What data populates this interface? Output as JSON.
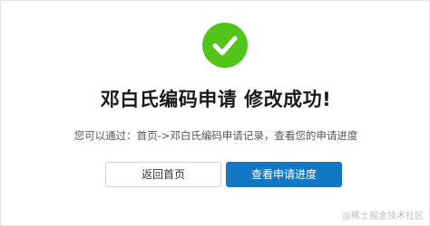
{
  "result": {
    "icon": "check-circle-icon",
    "icon_color": "#52c41a",
    "title": "邓白氏编码申请 修改成功!",
    "message": "您可以通过：首页->邓白氏编码申请记录，查看您的申请进度"
  },
  "actions": {
    "home_label": "返回首页",
    "progress_label": "查看申请进度",
    "primary_color": "#1477c4"
  },
  "watermark": "@稀土掘金技术社区"
}
